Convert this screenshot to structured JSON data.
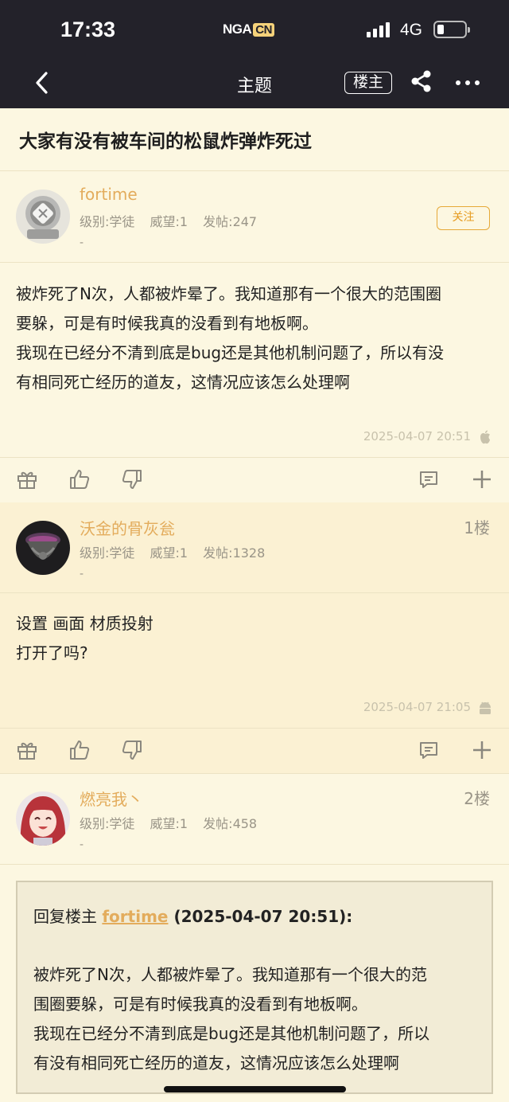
{
  "status_bar": {
    "time": "17:33",
    "logo_main": "NGA",
    "logo_badge": "CN",
    "network": "4G",
    "battery_level": 0.2
  },
  "nav": {
    "title": "主题",
    "owner_label": "楼主",
    "back_icon": "chevron-left-icon",
    "share_icon": "share-icon",
    "more_icon": "more-icon"
  },
  "thread": {
    "title": "大家有没有被车间的松鼠炸弹炸死过"
  },
  "posts": [
    {
      "username": "fortime",
      "level": "级别:学徒",
      "prestige": "威望:1",
      "post_count": "发帖:247",
      "signature": "-",
      "follow_label": "关注",
      "content": [
        "被炸死了N次，人都被炸晕了。我知道那有一个很大的范围圈",
        "要躲，可是有时候我真的没看到有地板啊。",
        "我现在已经分不清到底是bug还是其他机制问题了，所以有没",
        "有相同死亡经历的道友，这情况应该怎么处理啊"
      ],
      "timestamp": "2025-04-07 20:51",
      "device_icon": "apple-icon"
    },
    {
      "username": "沃金的骨灰瓮",
      "floor": "1楼",
      "level": "级别:学徒",
      "prestige": "威望:1",
      "post_count": "发帖:1328",
      "signature": "-",
      "content": [
        "设置 画面 材质投射",
        "打开了吗?"
      ],
      "timestamp": "2025-04-07 21:05",
      "device_icon": "android-icon"
    },
    {
      "username": "燃亮我丶",
      "floor": "2楼",
      "level": "级别:学徒",
      "prestige": "威望:1",
      "post_count": "发帖:458",
      "signature": "-",
      "quote": {
        "prefix": "回复楼主 ",
        "name": "fortime",
        "date": " (2025-04-07 20:51):",
        "content": [
          "被炸死了N次，人都被炸晕了。我知道那有一个很大的范",
          "围圈要躲，可是有时候我真的没看到有地板啊。",
          "我现在已经分不清到底是bug还是其他机制问题了，所以",
          "有没有相同死亡经历的道友，这情况应该怎么处理啊"
        ]
      }
    }
  ],
  "colors": {
    "bar_bg": "#23222a",
    "page_bg": "#fcf7e1",
    "alt_bg": "#fbf1d3",
    "username": "#e3ac5c",
    "follow": "#e69b1f"
  }
}
